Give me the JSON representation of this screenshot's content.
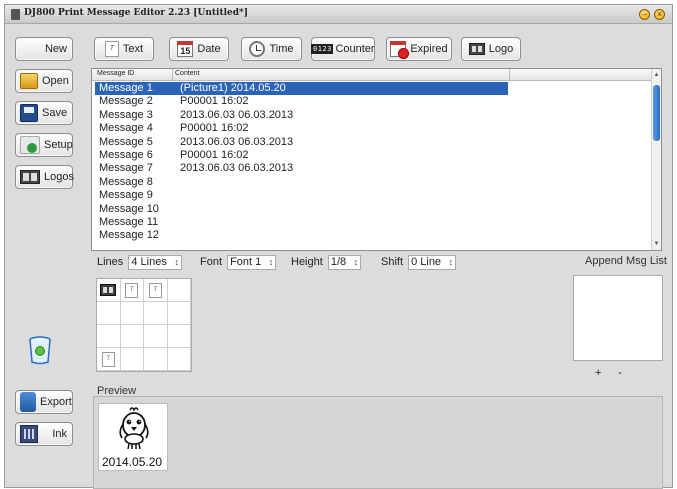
{
  "window": {
    "title": "DJ800 Print Message Editor 2.23 [Untitled*]",
    "min_glyph": "–",
    "close_glyph": "×"
  },
  "sidebar": {
    "new": "New",
    "open": "Open",
    "save": "Save",
    "setup": "Setup",
    "logos": "Logos",
    "export": "Export",
    "ink": "Ink"
  },
  "toolbar": {
    "text": "Text",
    "date": "Date",
    "time": "Time",
    "counter": "Counter",
    "expired": "Expired",
    "logo": "Logo",
    "date_icon_num": "15",
    "expired_icon_num": "15",
    "counter_icon_text": "0123"
  },
  "table": {
    "columns": [
      "Message ID",
      "Content"
    ],
    "rows": [
      {
        "id": "Message 1",
        "content": "(Picture1)  2014.05.20"
      },
      {
        "id": "Message 2",
        "content": "P00001  16:02"
      },
      {
        "id": "Message 3",
        "content": "2013.06.03  06.03.2013"
      },
      {
        "id": "Message 4",
        "content": "P00001  16:02"
      },
      {
        "id": "Message 5",
        "content": "2013.06.03  06.03.2013"
      },
      {
        "id": "Message 6",
        "content": "P00001  16:02"
      },
      {
        "id": "Message 7",
        "content": "2013.06.03  06.03.2013"
      },
      {
        "id": "Message 8",
        "content": ""
      },
      {
        "id": "Message 9",
        "content": ""
      },
      {
        "id": "Message 10",
        "content": ""
      },
      {
        "id": "Message 11",
        "content": ""
      },
      {
        "id": "Message 12",
        "content": ""
      }
    ],
    "selected_row": 0
  },
  "settings": {
    "lines_label": "Lines",
    "lines_value": "4 Lines",
    "font_label": "Font",
    "font_value": "Font 1",
    "height_label": "Height",
    "height_value": "1/8",
    "shift_label": "Shift",
    "shift_value": "0 Line"
  },
  "append": {
    "label": "Append Msg List",
    "plus": "+",
    "minus": "-"
  },
  "preview": {
    "label": "Preview",
    "text": "2014.05.20"
  },
  "colors": {
    "selection": "#2b63b8",
    "window_bg": "#dcdcdc"
  }
}
